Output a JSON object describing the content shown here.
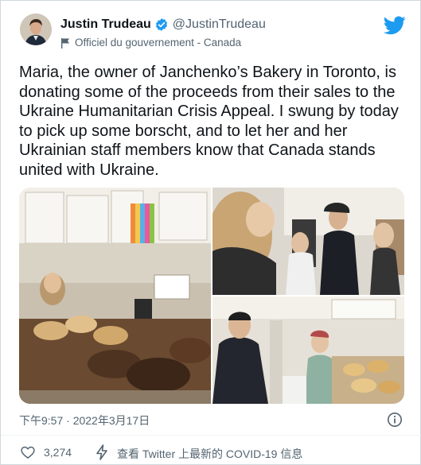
{
  "author": {
    "display_name": "Justin Trudeau",
    "handle": "@JustinTrudeau",
    "label": "Officiel du gouvernement - Canada"
  },
  "icons": {
    "verified": "verified-badge-icon",
    "flag": "government-flag-icon",
    "brand": "twitter-bird-icon",
    "info": "info-icon",
    "like": "heart-icon",
    "covid": "lightning-bolt-icon"
  },
  "colors": {
    "brand_blue": "#1d9bf0",
    "text_primary": "#0f1419",
    "text_secondary": "#536471"
  },
  "tweet": {
    "text": "Maria, the owner of Janchenko’s Bakery in Toronto, is donating some of the proceeds from their sales to the Ukraine Humanitarian Crisis Appeal. I swung by today to pick up some borscht, and to let her and her Ukrainian staff members know that Canada stands united with Ukraine.",
    "timestamp": "下午9:57 · 2022年3月17日"
  },
  "actions": {
    "like_count": "3,274",
    "covid_link": "查看 Twitter 上最新的 COVID-19 信息"
  }
}
